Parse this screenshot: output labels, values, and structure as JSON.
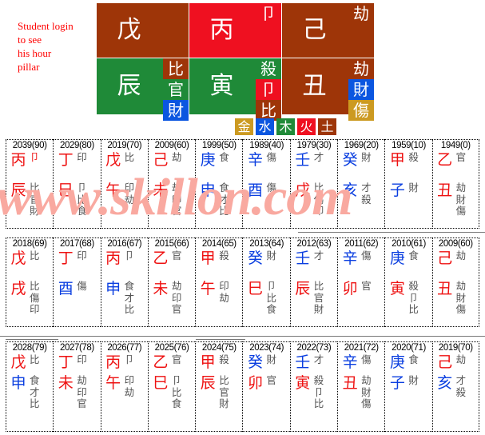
{
  "note": {
    "text": "Student login to see his hour pillar",
    "color": "#ff0000",
    "lines": [
      "Student login",
      "to see",
      "his hour",
      "pillar"
    ]
  },
  "legend": {
    "label": "five-elements-legend",
    "items": [
      {
        "char": "金",
        "element": "metal",
        "color": "#cc9a21"
      },
      {
        "char": "水",
        "element": "water",
        "color": "#0b56e0"
      },
      {
        "char": "木",
        "element": "wood",
        "color": "#1f8a38"
      },
      {
        "char": "火",
        "element": "fire",
        "color": "#ef1020"
      },
      {
        "char": "土",
        "element": "earth",
        "color": "#9e3508"
      }
    ]
  },
  "natal_chart": {
    "pillars": [
      {
        "name": "day-pillar-left",
        "stem": {
          "char": "戊",
          "element": "earth",
          "gods": []
        },
        "branch": {
          "char": "辰",
          "element": "wood",
          "gods": [
            {
              "char": "比",
              "element": "earth"
            },
            {
              "char": "官",
              "element": "wood"
            },
            {
              "char": "財",
              "element": "water"
            }
          ]
        }
      },
      {
        "name": "month-pillar",
        "stem": {
          "char": "丙",
          "element": "fire",
          "gods": [
            {
              "char": "卩",
              "element": "fire"
            }
          ]
        },
        "branch": {
          "char": "寅",
          "element": "wood",
          "gods": [
            {
              "char": "殺",
              "element": "wood"
            },
            {
              "char": "卩",
              "element": "fire"
            },
            {
              "char": "比",
              "element": "earth"
            }
          ]
        }
      },
      {
        "name": "year-pillar",
        "stem": {
          "char": "己",
          "element": "earth",
          "gods": [
            {
              "char": "劫",
              "element": "earth"
            }
          ]
        },
        "branch": {
          "char": "丑",
          "element": "earth",
          "gods": [
            {
              "char": "劫",
              "element": "earth"
            },
            {
              "char": "財",
              "element": "water"
            },
            {
              "char": "傷",
              "element": "metal"
            }
          ]
        }
      }
    ]
  },
  "luck_rows": [
    {
      "name": "decade-luck-pillars",
      "cells": [
        {
          "year": "2039(90)",
          "stem": {
            "char": "丙",
            "color": "fire"
          },
          "stem_god": {
            "char": "卩",
            "color": "fire"
          },
          "branch": {
            "char": "辰",
            "color": "fire"
          },
          "gods": [
            {
              "char": "比",
              "color": "gray"
            },
            {
              "char": "官",
              "color": "gray"
            },
            {
              "char": "財",
              "color": "gray"
            }
          ]
        },
        {
          "year": "2029(80)",
          "stem": {
            "char": "丁",
            "color": "fire"
          },
          "stem_god": {
            "char": "印",
            "color": "gray"
          },
          "branch": {
            "char": "巳",
            "color": "fire"
          },
          "gods": [
            {
              "char": "卩",
              "color": "gray"
            },
            {
              "char": "比",
              "color": "gray"
            },
            {
              "char": "食",
              "color": "gray"
            }
          ]
        },
        {
          "year": "2019(70)",
          "stem": {
            "char": "戊",
            "color": "fire"
          },
          "stem_god": {
            "char": "比",
            "color": "gray"
          },
          "branch": {
            "char": "午",
            "color": "fire"
          },
          "gods": [
            {
              "char": "印",
              "color": "gray"
            },
            {
              "char": "劫",
              "color": "gray"
            }
          ]
        },
        {
          "year": "2009(60)",
          "stem": {
            "char": "己",
            "color": "fire"
          },
          "stem_god": {
            "char": "劫",
            "color": "gray"
          },
          "branch": {
            "char": "未",
            "color": "fire"
          },
          "gods": [
            {
              "char": "劫",
              "color": "gray"
            },
            {
              "char": "印",
              "color": "gray"
            },
            {
              "char": "官",
              "color": "gray"
            }
          ]
        },
        {
          "year": "1999(50)",
          "stem": {
            "char": "庚",
            "color": "water"
          },
          "stem_god": {
            "char": "食",
            "color": "gray"
          },
          "branch": {
            "char": "申",
            "color": "water"
          },
          "gods": [
            {
              "char": "食",
              "color": "gray"
            },
            {
              "char": "才",
              "color": "gray"
            },
            {
              "char": "比",
              "color": "gray"
            }
          ]
        },
        {
          "year": "1989(40)",
          "stem": {
            "char": "辛",
            "color": "water"
          },
          "stem_god": {
            "char": "傷",
            "color": "gray"
          },
          "branch": {
            "char": "酉",
            "color": "water"
          },
          "gods": [
            {
              "char": "傷",
              "color": "gray"
            }
          ]
        },
        {
          "year": "1979(30)",
          "stem": {
            "char": "壬",
            "color": "water"
          },
          "stem_god": {
            "char": "才",
            "color": "gray"
          },
          "branch": {
            "char": "戌",
            "color": "fire"
          },
          "gods": [
            {
              "char": "比",
              "color": "gray"
            },
            {
              "char": "傷",
              "color": "gray"
            },
            {
              "char": "印",
              "color": "gray"
            }
          ]
        },
        {
          "year": "1969(20)",
          "stem": {
            "char": "癸",
            "color": "water"
          },
          "stem_god": {
            "char": "財",
            "color": "gray"
          },
          "branch": {
            "char": "亥",
            "color": "water"
          },
          "gods": [
            {
              "char": "才",
              "color": "gray"
            },
            {
              "char": "殺",
              "color": "gray"
            }
          ]
        },
        {
          "year": "1959(10)",
          "stem": {
            "char": "甲",
            "color": "fire"
          },
          "stem_god": {
            "char": "殺",
            "color": "gray"
          },
          "branch": {
            "char": "子",
            "color": "water"
          },
          "gods": [
            {
              "char": "財",
              "color": "gray"
            }
          ]
        },
        {
          "year": "1949(0)",
          "stem": {
            "char": "乙",
            "color": "fire"
          },
          "stem_god": {
            "char": "官",
            "color": "gray"
          },
          "branch": {
            "char": "丑",
            "color": "fire"
          },
          "gods": [
            {
              "char": "劫",
              "color": "gray"
            },
            {
              "char": "財",
              "color": "gray"
            },
            {
              "char": "傷",
              "color": "gray"
            }
          ]
        }
      ]
    },
    {
      "name": "annual-luck-pillars-upper",
      "cells": [
        {
          "year": "2018(69)",
          "stem": {
            "char": "戊",
            "color": "fire"
          },
          "stem_god": {
            "char": "比",
            "color": "gray"
          },
          "branch": {
            "char": "戌",
            "color": "fire"
          },
          "gods": [
            {
              "char": "比",
              "color": "gray"
            },
            {
              "char": "傷",
              "color": "gray"
            },
            {
              "char": "印",
              "color": "gray"
            }
          ]
        },
        {
          "year": "2017(68)",
          "stem": {
            "char": "丁",
            "color": "fire"
          },
          "stem_god": {
            "char": "印",
            "color": "gray"
          },
          "branch": {
            "char": "酉",
            "color": "water"
          },
          "gods": [
            {
              "char": "傷",
              "color": "gray"
            }
          ]
        },
        {
          "year": "2016(67)",
          "stem": {
            "char": "丙",
            "color": "fire"
          },
          "stem_god": {
            "char": "卩",
            "color": "gray"
          },
          "branch": {
            "char": "申",
            "color": "water"
          },
          "gods": [
            {
              "char": "食",
              "color": "gray"
            },
            {
              "char": "才",
              "color": "gray"
            },
            {
              "char": "比",
              "color": "gray"
            }
          ]
        },
        {
          "year": "2015(66)",
          "stem": {
            "char": "乙",
            "color": "fire"
          },
          "stem_god": {
            "char": "官",
            "color": "gray"
          },
          "branch": {
            "char": "未",
            "color": "fire"
          },
          "gods": [
            {
              "char": "劫",
              "color": "gray"
            },
            {
              "char": "印",
              "color": "gray"
            },
            {
              "char": "官",
              "color": "gray"
            }
          ]
        },
        {
          "year": "2014(65)",
          "stem": {
            "char": "甲",
            "color": "fire"
          },
          "stem_god": {
            "char": "殺",
            "color": "gray"
          },
          "branch": {
            "char": "午",
            "color": "fire"
          },
          "gods": [
            {
              "char": "印",
              "color": "gray"
            },
            {
              "char": "劫",
              "color": "gray"
            }
          ]
        },
        {
          "year": "2013(64)",
          "stem": {
            "char": "癸",
            "color": "water"
          },
          "stem_god": {
            "char": "財",
            "color": "gray"
          },
          "branch": {
            "char": "巳",
            "color": "fire"
          },
          "gods": [
            {
              "char": "卩",
              "color": "gray"
            },
            {
              "char": "比",
              "color": "gray"
            },
            {
              "char": "食",
              "color": "gray"
            }
          ]
        },
        {
          "year": "2012(63)",
          "stem": {
            "char": "壬",
            "color": "water"
          },
          "stem_god": {
            "char": "才",
            "color": "gray"
          },
          "branch": {
            "char": "辰",
            "color": "fire"
          },
          "gods": [
            {
              "char": "比",
              "color": "gray"
            },
            {
              "char": "官",
              "color": "gray"
            },
            {
              "char": "財",
              "color": "gray"
            }
          ]
        },
        {
          "year": "2011(62)",
          "stem": {
            "char": "辛",
            "color": "water"
          },
          "stem_god": {
            "char": "傷",
            "color": "gray"
          },
          "branch": {
            "char": "卯",
            "color": "fire"
          },
          "gods": [
            {
              "char": "官",
              "color": "gray"
            }
          ]
        },
        {
          "year": "2010(61)",
          "stem": {
            "char": "庚",
            "color": "water"
          },
          "stem_god": {
            "char": "食",
            "color": "gray"
          },
          "branch": {
            "char": "寅",
            "color": "fire"
          },
          "gods": [
            {
              "char": "殺",
              "color": "gray"
            },
            {
              "char": "卩",
              "color": "gray"
            },
            {
              "char": "比",
              "color": "gray"
            }
          ]
        },
        {
          "year": "2009(60)",
          "stem": {
            "char": "己",
            "color": "fire"
          },
          "stem_god": {
            "char": "劫",
            "color": "gray"
          },
          "branch": {
            "char": "丑",
            "color": "fire"
          },
          "gods": [
            {
              "char": "劫",
              "color": "gray"
            },
            {
              "char": "財",
              "color": "gray"
            },
            {
              "char": "傷",
              "color": "gray"
            }
          ]
        }
      ]
    },
    {
      "name": "annual-luck-pillars-lower",
      "cells": [
        {
          "year": "2028(79)",
          "stem": {
            "char": "戊",
            "color": "fire"
          },
          "stem_god": {
            "char": "比",
            "color": "gray"
          },
          "branch": {
            "char": "申",
            "color": "water"
          },
          "gods": [
            {
              "char": "食",
              "color": "gray"
            },
            {
              "char": "才",
              "color": "gray"
            },
            {
              "char": "比",
              "color": "gray"
            }
          ]
        },
        {
          "year": "2027(78)",
          "stem": {
            "char": "丁",
            "color": "fire"
          },
          "stem_god": {
            "char": "印",
            "color": "gray"
          },
          "branch": {
            "char": "未",
            "color": "fire"
          },
          "gods": [
            {
              "char": "劫",
              "color": "gray"
            },
            {
              "char": "印",
              "color": "gray"
            },
            {
              "char": "官",
              "color": "gray"
            }
          ]
        },
        {
          "year": "2026(77)",
          "stem": {
            "char": "丙",
            "color": "fire"
          },
          "stem_god": {
            "char": "卩",
            "color": "gray"
          },
          "branch": {
            "char": "午",
            "color": "fire"
          },
          "gods": [
            {
              "char": "印",
              "color": "gray"
            },
            {
              "char": "劫",
              "color": "gray"
            }
          ]
        },
        {
          "year": "2025(76)",
          "stem": {
            "char": "乙",
            "color": "fire"
          },
          "stem_god": {
            "char": "官",
            "color": "gray"
          },
          "branch": {
            "char": "巳",
            "color": "fire"
          },
          "gods": [
            {
              "char": "卩",
              "color": "gray"
            },
            {
              "char": "比",
              "color": "gray"
            },
            {
              "char": "食",
              "color": "gray"
            }
          ]
        },
        {
          "year": "2024(75)",
          "stem": {
            "char": "甲",
            "color": "fire"
          },
          "stem_god": {
            "char": "殺",
            "color": "gray"
          },
          "branch": {
            "char": "辰",
            "color": "fire"
          },
          "gods": [
            {
              "char": "比",
              "color": "gray"
            },
            {
              "char": "官",
              "color": "gray"
            },
            {
              "char": "財",
              "color": "gray"
            }
          ]
        },
        {
          "year": "2023(74)",
          "stem": {
            "char": "癸",
            "color": "water"
          },
          "stem_god": {
            "char": "財",
            "color": "gray"
          },
          "branch": {
            "char": "卯",
            "color": "fire"
          },
          "gods": [
            {
              "char": "官",
              "color": "gray"
            }
          ]
        },
        {
          "year": "2022(73)",
          "stem": {
            "char": "壬",
            "color": "water"
          },
          "stem_god": {
            "char": "才",
            "color": "gray"
          },
          "branch": {
            "char": "寅",
            "color": "fire"
          },
          "gods": [
            {
              "char": "殺",
              "color": "gray"
            },
            {
              "char": "卩",
              "color": "gray"
            },
            {
              "char": "比",
              "color": "gray"
            }
          ]
        },
        {
          "year": "2021(72)",
          "stem": {
            "char": "辛",
            "color": "water"
          },
          "stem_god": {
            "char": "傷",
            "color": "gray"
          },
          "branch": {
            "char": "丑",
            "color": "fire"
          },
          "gods": [
            {
              "char": "劫",
              "color": "gray"
            },
            {
              "char": "財",
              "color": "gray"
            },
            {
              "char": "傷",
              "color": "gray"
            }
          ]
        },
        {
          "year": "2020(71)",
          "stem": {
            "char": "庚",
            "color": "water"
          },
          "stem_god": {
            "char": "食",
            "color": "gray"
          },
          "branch": {
            "char": "子",
            "color": "water"
          },
          "gods": [
            {
              "char": "財",
              "color": "gray"
            }
          ]
        },
        {
          "year": "2019(70)",
          "stem": {
            "char": "己",
            "color": "fire"
          },
          "stem_god": {
            "char": "劫",
            "color": "gray"
          },
          "branch": {
            "char": "亥",
            "color": "water"
          },
          "gods": [
            {
              "char": "才",
              "color": "gray"
            },
            {
              "char": "殺",
              "color": "gray"
            }
          ]
        }
      ]
    }
  ],
  "watermark": {
    "text": "www.skillon.com",
    "color": "#f9a9a0"
  }
}
